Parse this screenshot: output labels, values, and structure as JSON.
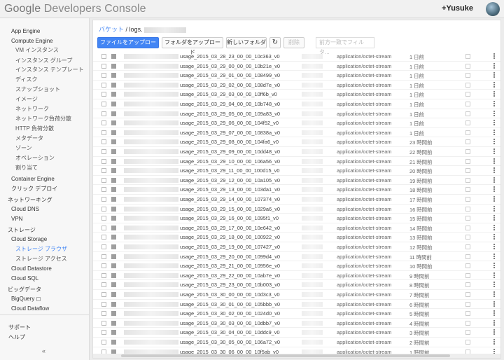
{
  "header": {
    "logo_google": "Google",
    "logo_product": "Developers Console",
    "user_name": "+Yusuke"
  },
  "sidebar": {
    "items": [
      {
        "label": "App Engine",
        "level": "sub"
      },
      {
        "label": "Compute Engine",
        "level": "sub"
      },
      {
        "label": "VM インスタンス",
        "level": "sub2"
      },
      {
        "label": "インスタンス グループ",
        "level": "sub2"
      },
      {
        "label": "インスタンス テンプレート",
        "level": "sub2"
      },
      {
        "label": "ディスク",
        "level": "sub2"
      },
      {
        "label": "スナップショット",
        "level": "sub2"
      },
      {
        "label": "イメージ",
        "level": "sub2"
      },
      {
        "label": "ネットワーク",
        "level": "sub2"
      },
      {
        "label": "ネットワーク負荷分散",
        "level": "sub2"
      },
      {
        "label": "HTTP 負荷分散",
        "level": "sub2"
      },
      {
        "label": "メタデータ",
        "level": "sub2"
      },
      {
        "label": "ゾーン",
        "level": "sub2"
      },
      {
        "label": "オペレーション",
        "level": "sub2"
      },
      {
        "label": "割り当て",
        "level": "sub2"
      },
      {
        "label": "Container Engine",
        "level": "sub"
      },
      {
        "label": "クリック デプロイ",
        "level": "sub"
      },
      {
        "label": "ネットワーキング",
        "level": "top"
      },
      {
        "label": "Cloud DNS",
        "level": "sub"
      },
      {
        "label": "VPN",
        "level": "sub"
      },
      {
        "label": "ストレージ",
        "level": "top"
      },
      {
        "label": "Cloud Storage",
        "level": "sub"
      },
      {
        "label": "ストレージ ブラウザ",
        "level": "sub2",
        "active": true
      },
      {
        "label": "ストレージ アクセス",
        "level": "sub2"
      },
      {
        "label": "Cloud Datastore",
        "level": "sub"
      },
      {
        "label": "Cloud SQL",
        "level": "sub"
      },
      {
        "label": "ビッグデータ",
        "level": "top"
      },
      {
        "label": "BigQuery",
        "level": "sub",
        "external": true
      },
      {
        "label": "Cloud Dataflow",
        "level": "sub"
      }
    ],
    "support": "サポート",
    "help": "ヘルプ",
    "collapse": "«"
  },
  "breadcrumb": {
    "bucket": "バケット",
    "sep": "/",
    "path": "logs."
  },
  "toolbar": {
    "upload_files": "ファイルをアップロード",
    "upload_folder": "フォルダをアップロード",
    "new_folder": "新しいフォルダ",
    "refresh": "↻",
    "delete": "削除",
    "filter_placeholder": "前方一致でフィルタ..."
  },
  "files": [
    {
      "name": "usage_2015_03_28_23_00_00_10c363_v0",
      "type": "application/octet-stream",
      "age": "1 日前"
    },
    {
      "name": "usage_2015_03_29_00_00_00_10b21e_v0",
      "type": "application/octet-stream",
      "age": "1 日前"
    },
    {
      "name": "usage_2015_03_29_01_00_00_108499_v0",
      "type": "application/octet-stream",
      "age": "1 日前"
    },
    {
      "name": "usage_2015_03_29_02_00_00_108d7e_v0",
      "type": "application/octet-stream",
      "age": "1 日前"
    },
    {
      "name": "usage_2015_03_29_03_00_00_10ff6b_v0",
      "type": "application/octet-stream",
      "age": "1 日前"
    },
    {
      "name": "usage_2015_03_29_04_00_00_10b748_v0",
      "type": "application/octet-stream",
      "age": "1 日前"
    },
    {
      "name": "usage_2015_03_29_05_00_00_109a83_v0",
      "type": "application/octet-stream",
      "age": "1 日前"
    },
    {
      "name": "usage_2015_03_29_06_00_00_104f52_v0",
      "type": "application/octet-stream",
      "age": "1 日前"
    },
    {
      "name": "usage_2015_03_29_07_00_00_10838a_v0",
      "type": "application/octet-stream",
      "age": "1 日前"
    },
    {
      "name": "usage_2015_03_29_08_00_00_104fa6_v0",
      "type": "application/octet-stream",
      "age": "23 時間前"
    },
    {
      "name": "usage_2015_03_29_09_00_00_10dd48_v0",
      "type": "application/octet-stream",
      "age": "22 時間前"
    },
    {
      "name": "usage_2015_03_29_10_00_00_106a56_v0",
      "type": "application/octet-stream",
      "age": "21 時間前"
    },
    {
      "name": "usage_2015_03_29_11_00_00_100d15_v0",
      "type": "application/octet-stream",
      "age": "20 時間前"
    },
    {
      "name": "usage_2015_03_29_12_00_00_10a105_v0",
      "type": "application/octet-stream",
      "age": "19 時間前"
    },
    {
      "name": "usage_2015_03_29_13_00_00_103da1_v0",
      "type": "application/octet-stream",
      "age": "18 時間前"
    },
    {
      "name": "usage_2015_03_29_14_00_00_107374_v0",
      "type": "application/octet-stream",
      "age": "17 時間前"
    },
    {
      "name": "usage_2015_03_29_15_00_00_1029a6_v0",
      "type": "application/octet-stream",
      "age": "16 時間前"
    },
    {
      "name": "usage_2015_03_29_16_00_00_1095f1_v0",
      "type": "application/octet-stream",
      "age": "15 時間前"
    },
    {
      "name": "usage_2015_03_29_17_00_00_10e642_v0",
      "type": "application/octet-stream",
      "age": "14 時間前"
    },
    {
      "name": "usage_2015_03_29_18_00_00_100922_v0",
      "type": "application/octet-stream",
      "age": "13 時間前"
    },
    {
      "name": "usage_2015_03_29_19_00_00_107427_v0",
      "type": "application/octet-stream",
      "age": "12 時間前"
    },
    {
      "name": "usage_2015_03_29_20_00_00_1099d4_v0",
      "type": "application/octet-stream",
      "age": "11 時間前"
    },
    {
      "name": "usage_2015_03_29_21_00_00_10956e_v0",
      "type": "application/octet-stream",
      "age": "10 時間前"
    },
    {
      "name": "usage_2015_03_29_22_00_00_10ab7e_v0",
      "type": "application/octet-stream",
      "age": "9 時間前"
    },
    {
      "name": "usage_2015_03_29_23_00_00_10b003_v0",
      "type": "application/octet-stream",
      "age": "8 時間前"
    },
    {
      "name": "usage_2015_03_30_00_00_00_10d3c3_v0",
      "type": "application/octet-stream",
      "age": "7 時間前"
    },
    {
      "name": "usage_2015_03_30_01_00_00_105bbb_v0",
      "type": "application/octet-stream",
      "age": "6 時間前"
    },
    {
      "name": "usage_2015_03_30_02_00_00_1024d0_v0",
      "type": "application/octet-stream",
      "age": "5 時間前"
    },
    {
      "name": "usage_2015_03_30_03_00_00_10dbb7_v0",
      "type": "application/octet-stream",
      "age": "4 時間前"
    },
    {
      "name": "usage_2015_03_30_04_00_00_10ddc9_v0",
      "type": "application/octet-stream",
      "age": "3 時間前"
    },
    {
      "name": "usage_2015_03_30_05_00_00_106a72_v0",
      "type": "application/octet-stream",
      "age": "2 時間前"
    },
    {
      "name": "usage_2015_03_30_06_00_00_10f5ab_v0",
      "type": "application/octet-stream",
      "age": "1 時間前"
    }
  ]
}
